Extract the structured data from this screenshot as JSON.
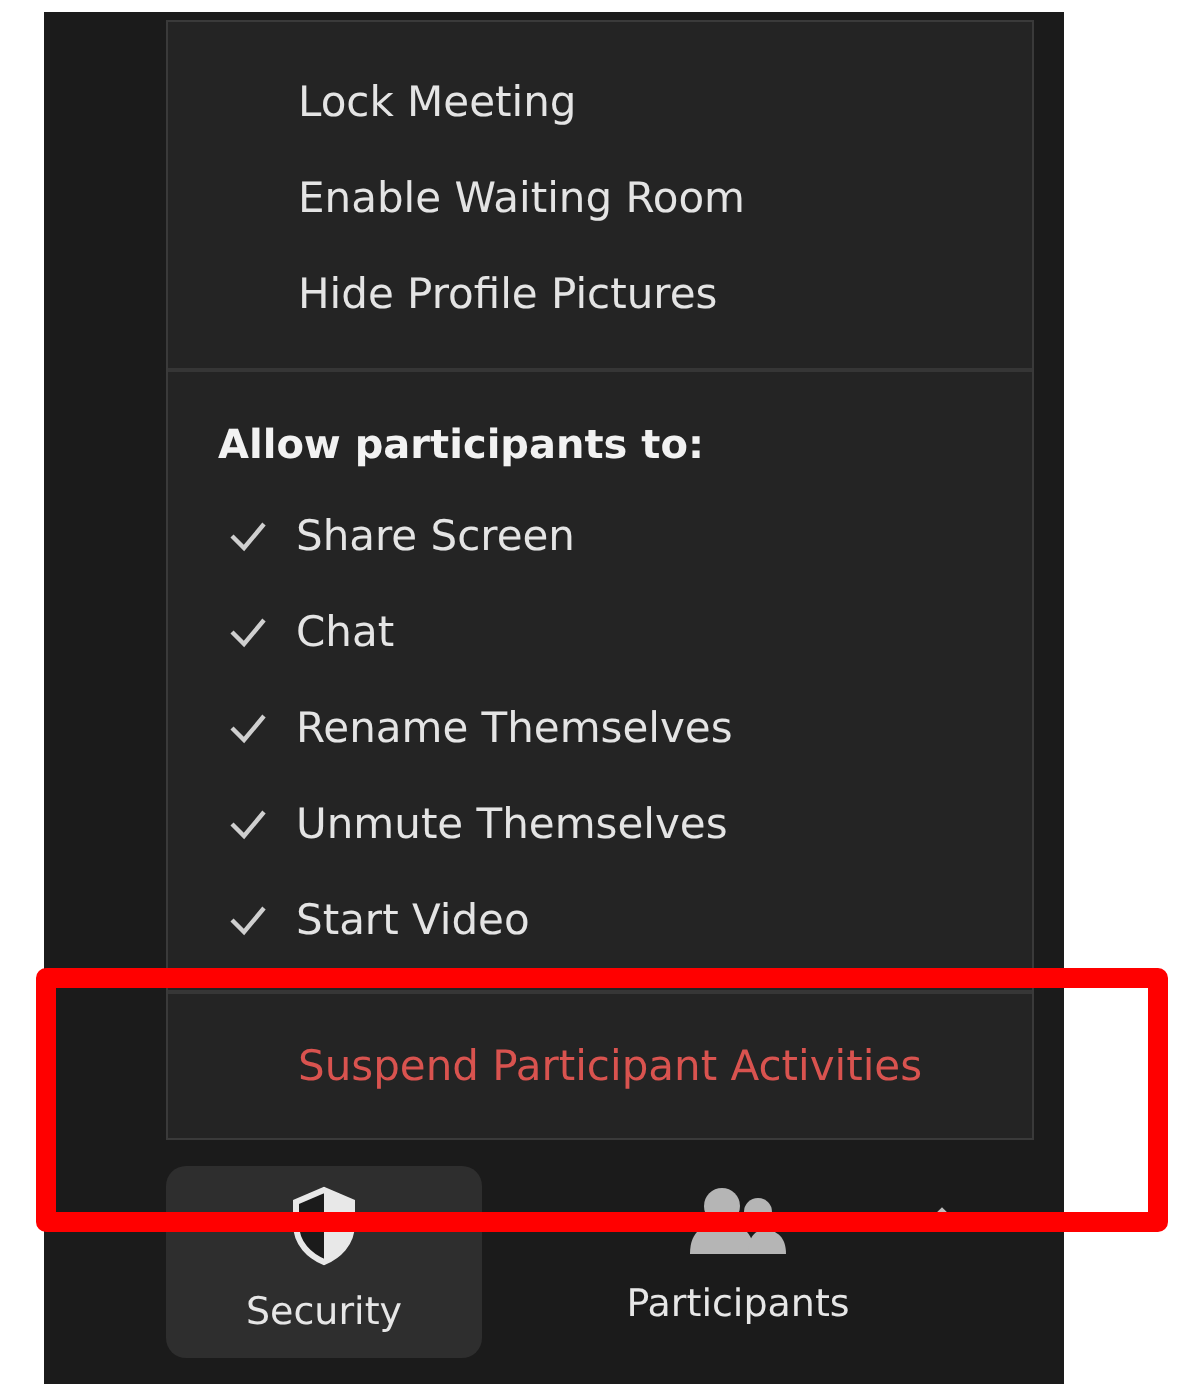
{
  "security_menu": {
    "items": [
      {
        "label": "Lock Meeting"
      },
      {
        "label": "Enable Waiting Room"
      },
      {
        "label": "Hide Profile Pictures"
      }
    ],
    "allow_section": {
      "heading": "Allow participants to:",
      "options": [
        {
          "label": "Share Screen",
          "checked": true
        },
        {
          "label": "Chat",
          "checked": true
        },
        {
          "label": "Rename Themselves",
          "checked": true
        },
        {
          "label": "Unmute Themselves",
          "checked": true
        },
        {
          "label": "Start Video",
          "checked": true
        }
      ]
    },
    "danger_action": {
      "label": "Suspend Participant Activities"
    }
  },
  "toolbar": [
    {
      "label": "Security",
      "kind": "security",
      "selected": true
    },
    {
      "label": "Participants",
      "kind": "participants",
      "selected": false
    }
  ]
}
